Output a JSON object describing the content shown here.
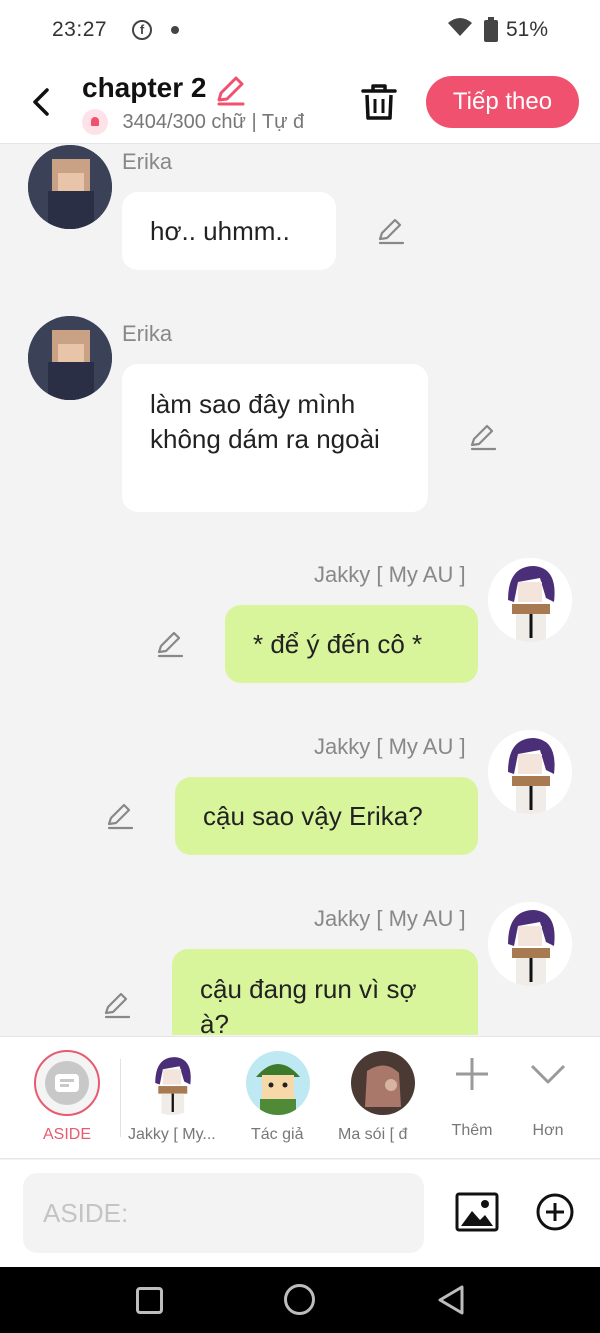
{
  "status_bar": {
    "time": "23:27",
    "battery": "51%",
    "icons": [
      "facebook-icon",
      "dot-icon",
      "wifi-icon",
      "battery-icon"
    ]
  },
  "header": {
    "title": "chapter 2",
    "info": "3404/300 chữ | Tự đ",
    "next_label": "Tiếp theo",
    "accent_color": "#f0516e"
  },
  "messages": [
    {
      "sender": "Erika",
      "side": "left",
      "text": "hơ.. uhmm.."
    },
    {
      "sender": "Erika",
      "side": "left",
      "text": "làm sao đây mình không dám ra ngoài"
    },
    {
      "sender": "Jakky [ My AU ]",
      "side": "right",
      "text": "* để ý đến cô *"
    },
    {
      "sender": "Jakky [ My AU ]",
      "side": "right",
      "text": "cậu sao vậy Erika?"
    },
    {
      "sender": "Jakky [ My AU ]",
      "side": "right",
      "text": "cậu đang run vì sợ à?"
    }
  ],
  "characters": {
    "aside_label": "ASIDE",
    "items": [
      {
        "label": "Jakky [ My..."
      },
      {
        "label": "Tác giả"
      },
      {
        "label": "Ma sói [ đ"
      }
    ],
    "add_label": "Thêm",
    "more_label": "Hơn"
  },
  "composer": {
    "placeholder": "ASIDE:",
    "value": ""
  },
  "colors": {
    "left_bubble": "#ffffff",
    "right_bubble": "#d9f59c",
    "aside": "#e85a6e"
  }
}
